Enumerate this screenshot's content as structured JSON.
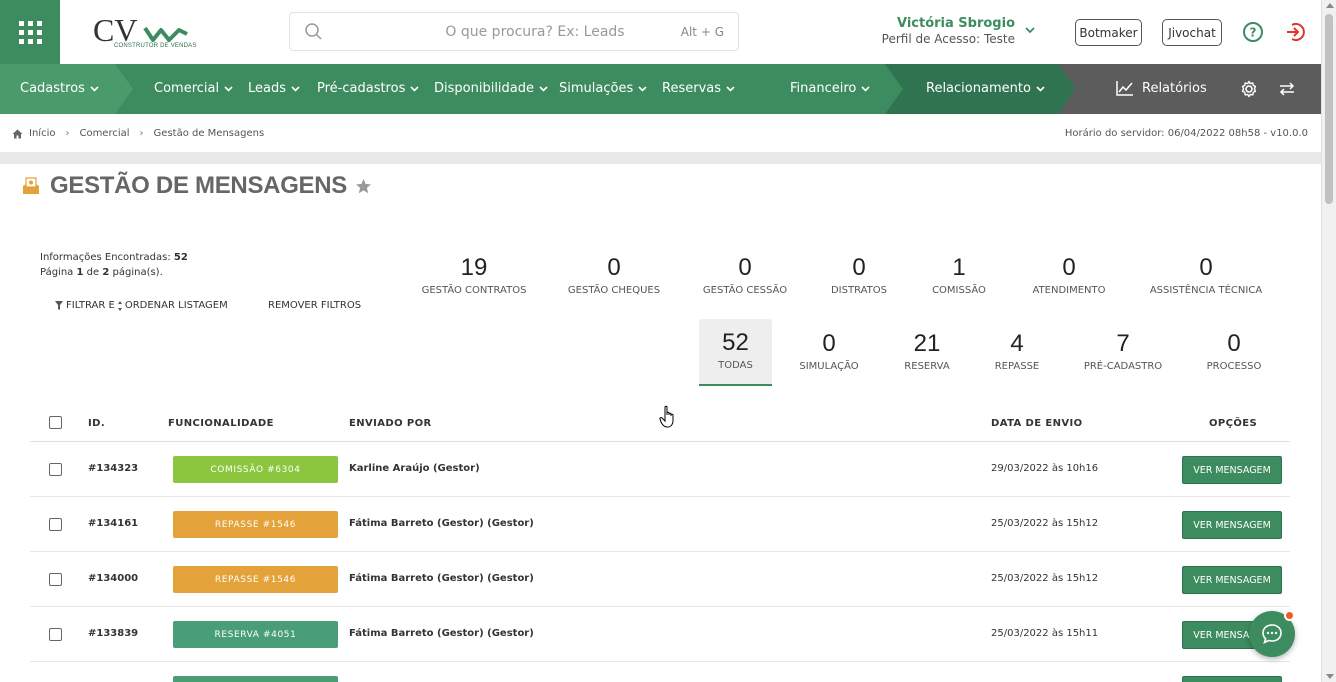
{
  "header": {
    "logo_text": "CV",
    "logo_subtitle": "CONSTRUTOR DE VENDAS",
    "search_placeholder": "O que procura? Ex: Leads",
    "search_shortcut": "Alt + G",
    "user_name": "Victória Sbrogio",
    "user_profile": "Perfil de Acesso: Teste",
    "botmaker_label": "Botmaker",
    "jivochat_label": "Jivochat"
  },
  "nav": {
    "items": [
      {
        "label": "Cadastros"
      },
      {
        "label": "Comercial"
      },
      {
        "label": "Leads"
      },
      {
        "label": "Pré-cadastros"
      },
      {
        "label": "Disponibilidade"
      },
      {
        "label": "Simulações"
      },
      {
        "label": "Reservas"
      },
      {
        "label": "Financeiro"
      },
      {
        "label": "Relacionamento"
      }
    ],
    "reports_label": "Relatórios"
  },
  "breadcrumb": {
    "items": [
      "Início",
      "Comercial",
      "Gestão de Mensagens"
    ],
    "server_time": "Horário do servidor: 06/04/2022 08h58 - v10.0.0"
  },
  "page": {
    "title": "GESTÃO DE MENSAGENS",
    "info_found_label": "Informações Encontradas:",
    "info_found_value": "52",
    "page_prefix": "Página",
    "page_current": "1",
    "page_of": "de",
    "page_total": "2",
    "page_suffix": "página(s).",
    "filter_label": "FILTRAR E",
    "order_label": "ORDENAR LISTAGEM",
    "remove_filters": "REMOVER FILTROS"
  },
  "stats_row1": [
    {
      "num": "19",
      "label": "GESTÃO CONTRATOS"
    },
    {
      "num": "0",
      "label": "GESTÃO CHEQUES"
    },
    {
      "num": "0",
      "label": "GESTÃO CESSÃO"
    },
    {
      "num": "0",
      "label": "DISTRATOS"
    },
    {
      "num": "1",
      "label": "COMISSÃO"
    },
    {
      "num": "0",
      "label": "ATENDIMENTO"
    },
    {
      "num": "0",
      "label": "ASSISTÊNCIA TÉCNICA"
    }
  ],
  "stats_row2": [
    {
      "num": "52",
      "label": "TODAS"
    },
    {
      "num": "0",
      "label": "SIMULAÇÃO"
    },
    {
      "num": "21",
      "label": "RESERVA"
    },
    {
      "num": "4",
      "label": "REPASSE"
    },
    {
      "num": "7",
      "label": "PRÉ-CADASTRO"
    },
    {
      "num": "0",
      "label": "PROCESSO"
    }
  ],
  "table": {
    "headers": {
      "id": "ID.",
      "feature": "FUNCIONALIDADE",
      "sender": "ENVIADO POR",
      "date": "DATA DE ENVIO",
      "options": "OPÇÕES"
    },
    "rows": [
      {
        "id": "#134323",
        "tag": "COMISSÃO #6304",
        "tag_color": "#8cc63f",
        "sender": "Karline Araújo (Gestor)",
        "date": "29/03/2022 às 10h16",
        "action": "VER MENSAGEM"
      },
      {
        "id": "#134161",
        "tag": "REPASSE #1546",
        "tag_color": "#e3a23a",
        "sender": "Fátima Barreto (Gestor) (Gestor)",
        "date": "25/03/2022 às 15h12",
        "action": "VER MENSAGEM"
      },
      {
        "id": "#134000",
        "tag": "REPASSE #1546",
        "tag_color": "#e3a23a",
        "sender": "Fátima Barreto (Gestor) (Gestor)",
        "date": "25/03/2022 às 15h12",
        "action": "VER MENSAGEM"
      },
      {
        "id": "#133839",
        "tag": "RESERVA #4051",
        "tag_color": "#4a9e77",
        "sender": "Fátima Barreto (Gestor) (Gestor)",
        "date": "25/03/2022 às 15h11",
        "action": "VER MENSAGEM"
      }
    ]
  },
  "colors": {
    "brand_green": "#3c8c60",
    "nav_dark": "#2f7350",
    "nav_gray": "#5c5c5c"
  }
}
